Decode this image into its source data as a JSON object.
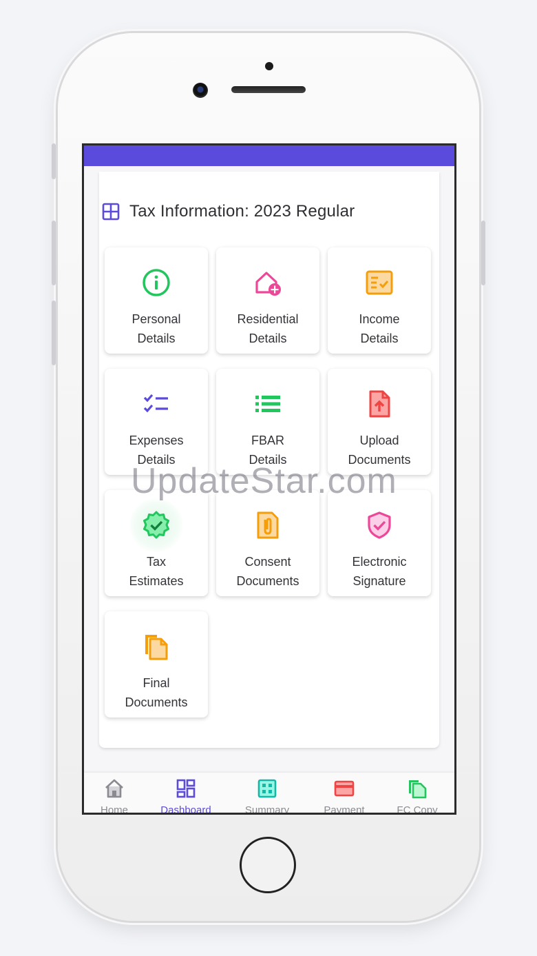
{
  "header": {
    "title": "Tax Information: 2023 Regular"
  },
  "tiles": [
    {
      "line1": "Personal",
      "line2": "Details",
      "icon": "info-icon",
      "color": "#22c55e"
    },
    {
      "line1": "Residential",
      "line2": "Details",
      "icon": "home-add-icon",
      "color": "#ec4899"
    },
    {
      "line1": "Income",
      "line2": "Details",
      "icon": "checklist-doc-icon",
      "color": "#f59e0b"
    },
    {
      "line1": "Expenses",
      "line2": "Details",
      "icon": "check-list-icon",
      "color": "#5a4bdc"
    },
    {
      "line1": "FBAR",
      "line2": "Details",
      "icon": "bullet-list-icon",
      "color": "#22c55e"
    },
    {
      "line1": "Upload",
      "line2": "Documents",
      "icon": "upload-file-icon",
      "color": "#ef4444"
    },
    {
      "line1": "Tax",
      "line2": "Estimates",
      "icon": "verified-badge-icon",
      "color": "#22c55e"
    },
    {
      "line1": "Consent",
      "line2": "Documents",
      "icon": "paperclip-doc-icon",
      "color": "#f59e0b"
    },
    {
      "line1": "Electronic",
      "line2": "Signature",
      "icon": "shield-check-icon",
      "color": "#ec4899"
    },
    {
      "line1": "Final",
      "line2": "Documents",
      "icon": "copy-file-icon",
      "color": "#f59e0b"
    }
  ],
  "bottom_nav": [
    {
      "label": "Home",
      "icon": "home-icon",
      "active": false
    },
    {
      "label": "Dashboard",
      "icon": "dashboard-icon",
      "active": true
    },
    {
      "label": "Summary",
      "icon": "summary-icon",
      "active": false
    },
    {
      "label": "Payment",
      "icon": "card-icon",
      "active": false
    },
    {
      "label": "FC Copy",
      "icon": "copy-icon",
      "active": false
    }
  ],
  "watermark": "UpdateStar.com",
  "colors": {
    "accent": "#5a4bdc",
    "green": "#22c55e",
    "pink": "#ec4899",
    "orange": "#f59e0b",
    "red": "#ef4444",
    "teal": "#14b8a6"
  }
}
